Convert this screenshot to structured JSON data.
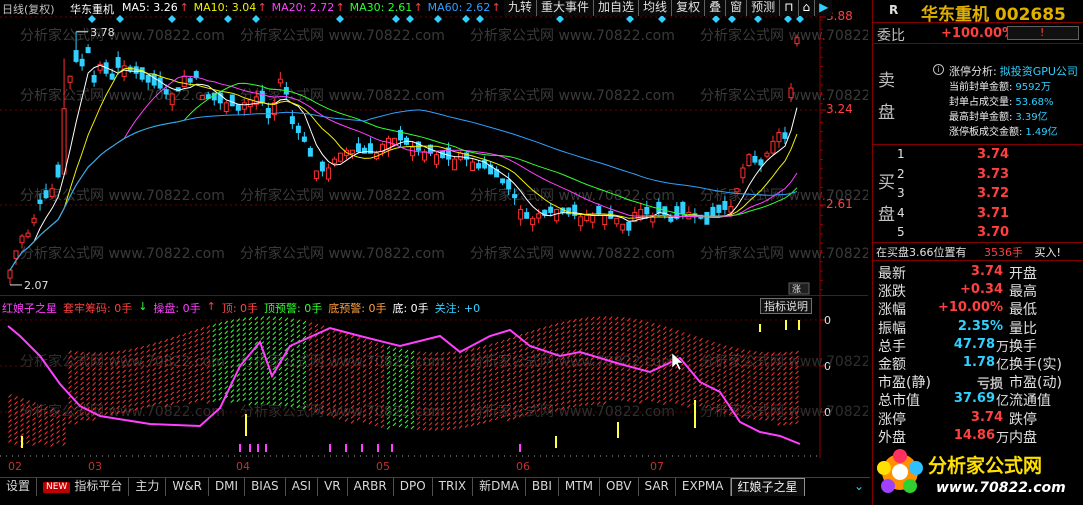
{
  "header": {
    "period": "日线(复权)",
    "stock": "华东重机",
    "ma": [
      {
        "label": "MA5: 3.26",
        "arrow": "↑",
        "color": "#ffffff"
      },
      {
        "label": "MA10: 3.04",
        "arrow": "↑",
        "color": "#f0f000"
      },
      {
        "label": "MA20: 2.72",
        "arrow": "↑",
        "color": "#ff40ff"
      },
      {
        "label": "MA30: 2.61",
        "arrow": "↑",
        "color": "#30ff30"
      },
      {
        "label": "MA60: 2.62",
        "arrow": "↑",
        "color": "#30a0ff"
      }
    ]
  },
  "toolbar": [
    "九转",
    "重大事件",
    "加自选",
    "均线",
    "复权",
    "叠",
    "窗",
    "预测"
  ],
  "price_axis": [
    "3.88",
    "3.24",
    "2.61"
  ],
  "chart_annotations": {
    "high": "3.78",
    "low": "2.07",
    "tag": "涨"
  },
  "watermark": "分析家公式网 www.70822.com",
  "indicator": {
    "name": "红娘子之星",
    "items": [
      {
        "text": "套牢筹码: 0手",
        "color": "#ff4040"
      },
      {
        "text": "↓",
        "color": "#30ff30"
      },
      {
        "text": "操盘: 0手",
        "color": "#ff40ff"
      },
      {
        "text": "↑",
        "color": "#ff4040"
      },
      {
        "text": "顶: 0手",
        "color": "#ff4040"
      },
      {
        "text": "顶预警: 0手",
        "color": "#30ff30"
      },
      {
        "text": "底预警: 0手",
        "color": "#ffa040"
      },
      {
        "text": "底: 0手",
        "color": "#ffffff"
      },
      {
        "text": "关注: +0",
        "color": "#30d0ff"
      }
    ],
    "help": "指标说明",
    "axis_labels": [
      "0",
      "0",
      "0"
    ]
  },
  "months": [
    "02",
    "03",
    "04",
    "05",
    "06",
    "07"
  ],
  "tabs": [
    "设置",
    "指标平台",
    "主力",
    "W&R",
    "DMI",
    "BIAS",
    "ASI",
    "VR",
    "ARBR",
    "DPO",
    "TRIX",
    "新DMA",
    "BBI",
    "MTM",
    "OBV",
    "SAR",
    "EXPMA",
    "红娘子之星"
  ],
  "tab_new_badge": "NEW",
  "panel": {
    "r": "R",
    "name": "华东重机 002685",
    "weibi_label": "委比",
    "weibi_value": "+100.00%",
    "sell_label": [
      "卖",
      "盘"
    ],
    "buy_label": [
      "买",
      "盘"
    ],
    "limit": [
      {
        "k": "涨停分析:",
        "v": "拟投资GPU公司"
      },
      {
        "k": "当前封单金额:",
        "v": "9592万"
      },
      {
        "k": "封单占成交量:",
        "v": "53.68%"
      },
      {
        "k": "最高封单金额:",
        "v": "3.39亿"
      },
      {
        "k": "涨停板成交金额:",
        "v": "1.49亿"
      }
    ],
    "bids": [
      {
        "level": "1",
        "price": "3.74"
      },
      {
        "level": "2",
        "price": "3.73"
      },
      {
        "level": "3",
        "price": "3.72"
      },
      {
        "level": "4",
        "price": "3.71"
      },
      {
        "level": "5",
        "price": "3.70"
      }
    ],
    "buy_notice": {
      "text": "在买盘3.66位置有",
      "vol": "3536手",
      "act": "买入!"
    },
    "quotes": [
      {
        "l": "最新",
        "v": "3.74",
        "r": "开盘",
        "vc": "#ff4040"
      },
      {
        "l": "涨跌",
        "v": "+0.34",
        "r": "最高",
        "vc": "#ff4040"
      },
      {
        "l": "涨幅",
        "v": "+10.00%",
        "r": "最低",
        "vc": "#ff4040"
      },
      {
        "l": "振幅",
        "v": "2.35%",
        "r": "量比",
        "vc": "#30d0ff"
      },
      {
        "l": "总手",
        "v": "47.78",
        "u": "万",
        "r": "换手",
        "vc": "#30d0ff"
      },
      {
        "l": "金额",
        "v": "1.78",
        "u": "亿",
        "r": "换手(实)",
        "vc": "#30d0ff"
      },
      {
        "l": "市盈(静)",
        "v": "亏损",
        "r": "市盈(动)",
        "vc": "#c0c0c0"
      },
      {
        "l": "总市值",
        "v": "37.69",
        "u": "亿",
        "r": "流通值",
        "vc": "#30d0ff"
      },
      {
        "l": "涨停",
        "v": "3.74",
        "r": "跌停",
        "vc": "#ff4040"
      },
      {
        "l": "外盘",
        "v": "14.86",
        "u": "万",
        "r": "内盘",
        "vc": "#ff4040"
      }
    ],
    "logo_text": "分析家公式网",
    "logo_url": "www.70822.com"
  }
}
